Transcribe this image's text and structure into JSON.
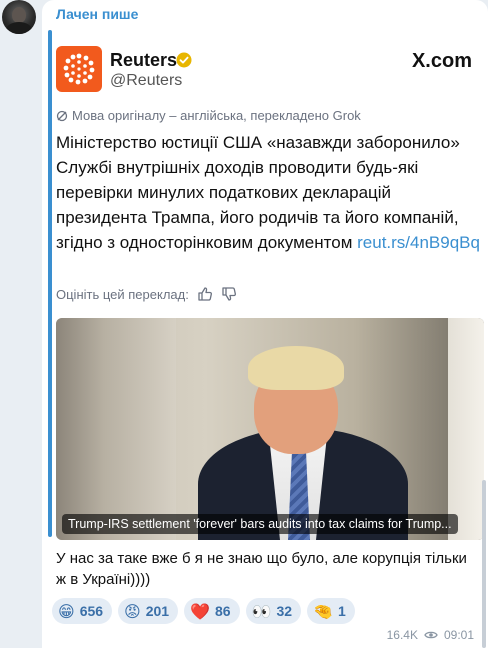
{
  "sender": {
    "name": "Лачен пише"
  },
  "tweet": {
    "account_name": "Reuters",
    "handle": "@Reuters",
    "platform": "X.com",
    "translation_note": "Мова оригіналу – англійська, перекладено Grok",
    "text": "Міністерство юстиції США «назавжди заборонило» Службі внутрішніх доходів проводити будь-які перевірки минулих податкових декларацій президента Трампа, його родичів та його компаній, згідно з односторінковим документом ",
    "link": "reut.rs/4nB9qBq",
    "rate_label": "Оцініть цей переклад:",
    "photo_caption": "Trump-IRS settlement 'forever' bars audits into tax claims for Trump..."
  },
  "message": {
    "text": "У нас за таке вже б я не знаю що було, але корупція тільки ж в Україні))))"
  },
  "reactions": [
    {
      "emoji": "😁",
      "count": "656"
    },
    {
      "emoji": "😡",
      "count": "201"
    },
    {
      "emoji": "❤️",
      "count": "86"
    },
    {
      "emoji": "👀",
      "count": "32"
    },
    {
      "emoji": "🤏",
      "count": "1"
    }
  ],
  "meta": {
    "views": "16.4K",
    "time": "09:01"
  },
  "colors": {
    "accent": "#3a8fd0",
    "reuters_orange": "#f25a1d",
    "verified": "#e8b600"
  },
  "icons": {
    "views": "eye-icon",
    "translate": "grok-icon",
    "like": "thumbs-up-icon",
    "dislike": "thumbs-down-icon"
  }
}
